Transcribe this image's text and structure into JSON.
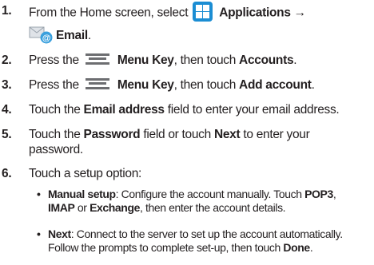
{
  "steps": [
    {
      "num": "1.",
      "pre": "From the Home screen, select",
      "bold1": "Applications →",
      "bold2": "Email",
      "post": "."
    },
    {
      "num": "2.",
      "pre": "Press the",
      "bold1": "Menu Key",
      "mid": ", then touch",
      "bold2": "Accounts",
      "post": "."
    },
    {
      "num": "3.",
      "pre": "Press the",
      "bold1": "Menu Key",
      "mid": ", then touch",
      "bold2": "Add account",
      "post": "."
    },
    {
      "num": "4.",
      "pre": "Touch the",
      "bold1": "Email address",
      "post": "field to enter your email address."
    },
    {
      "num": "5.",
      "pre": "Touch the",
      "bold1": "Password",
      "mid": "field or touch",
      "bold2": "Next",
      "post": "to enter your",
      "line2": "password."
    },
    {
      "num": "6.",
      "text": "Touch a setup option:"
    }
  ],
  "options": [
    {
      "bullet": "•",
      "label": "Manual setup",
      "line1": ": Configure the account manually. Touch",
      "b1": "POP3",
      "sep1": ",",
      "b2": "IMAP",
      "sep2": "or",
      "b3": "Exchange",
      "line2": ", then enter the account details."
    },
    {
      "bullet": "•",
      "label": "Next",
      "line1": ": Connect to the server to set up the account automatically.",
      "line2a": "Follow the prompts to complete set-up, then touch",
      "b1": "Done",
      "post": "."
    }
  ],
  "icons": {
    "applications": "applications-grid-icon",
    "email": "email-at-icon",
    "menu_key": "menu-key-icon"
  },
  "colors": {
    "applications_icon": "#1b8dd3",
    "text": "#231f20",
    "menu_key": "#6d6e71"
  }
}
